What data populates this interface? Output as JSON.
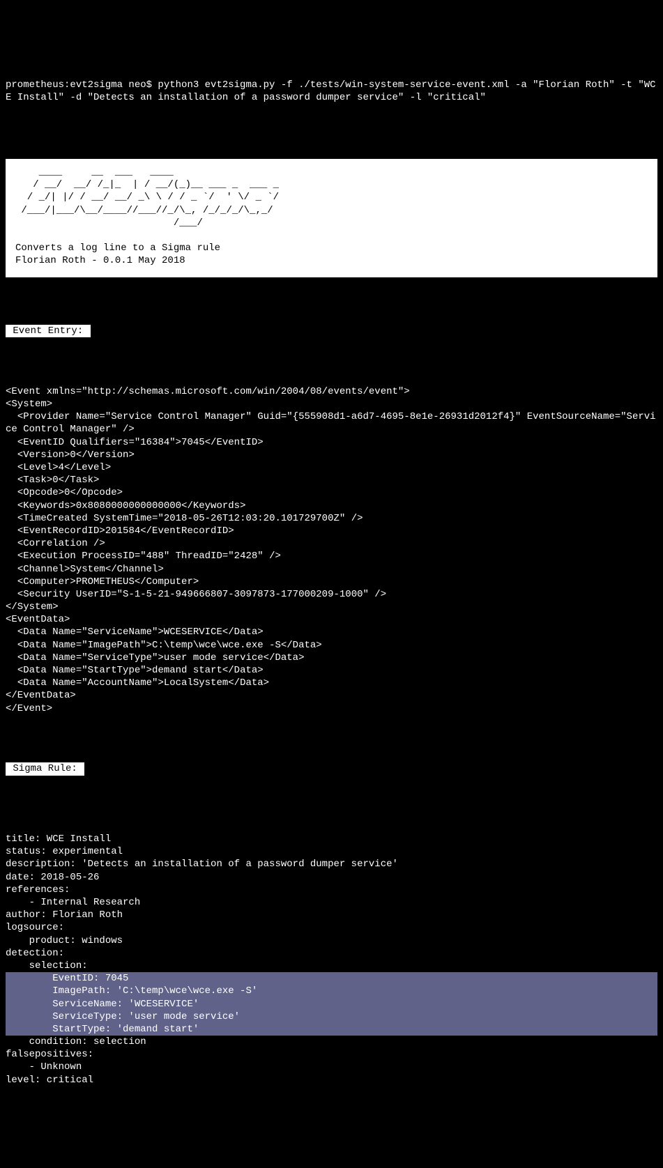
{
  "command": "prometheus:evt2sigma neo$ python3 evt2sigma.py -f ./tests/win-system-service-event.xml -a \"Florian Roth\" -t \"WCE Install\" -d \"Detects an installation of a password dumper service\" -l \"critical\"",
  "banner": {
    "ascii": "    ____     __  ___   ____                \n   / __/  __/ /_|_  | / __/(_)__ ___ _  ___ _\n  / _/| |/ / __/ __/ _\\ \\ / / _ `/  ' \\/ _ `/\n /___/|___/\\__/____//___//_/\\_, /_/_/_/\\_,_/ \n                           /___/             ",
    "tagline": "Converts a log line to a Sigma rule",
    "byline": "Florian Roth - 0.0.1 May 2018"
  },
  "labels": {
    "event_entry": " Event Entry: ",
    "sigma_rule": " Sigma Rule: "
  },
  "xml": "<Event xmlns=\"http://schemas.microsoft.com/win/2004/08/events/event\">\n<System>\n  <Provider Name=\"Service Control Manager\" Guid=\"{555908d1-a6d7-4695-8e1e-26931d2012f4}\" EventSourceName=\"Service Control Manager\" />\n  <EventID Qualifiers=\"16384\">7045</EventID>\n  <Version>0</Version>\n  <Level>4</Level>\n  <Task>0</Task>\n  <Opcode>0</Opcode>\n  <Keywords>0x8080000000000000</Keywords>\n  <TimeCreated SystemTime=\"2018-05-26T12:03:20.101729700Z\" />\n  <EventRecordID>201584</EventRecordID>\n  <Correlation />\n  <Execution ProcessID=\"488\" ThreadID=\"2428\" />\n  <Channel>System</Channel>\n  <Computer>PROMETHEUS</Computer>\n  <Security UserID=\"S-1-5-21-949666807-3097873-177000209-1000\" />\n</System>\n<EventData>\n  <Data Name=\"ServiceName\">WCESERVICE</Data>\n  <Data Name=\"ImagePath\">C:\\temp\\wce\\wce.exe -S</Data>\n  <Data Name=\"ServiceType\">user mode service</Data>\n  <Data Name=\"StartType\">demand start</Data>\n  <Data Name=\"AccountName\">LocalSystem</Data>\n</EventData>\n</Event>",
  "yaml_before": "title: WCE Install\nstatus: experimental\ndescription: 'Detects an installation of a password dumper service'\ndate: 2018-05-26\nreferences:\n    - Internal Research\nauthor: Florian Roth\nlogsource:\n    product: windows\ndetection:\n    selection:",
  "yaml_highlight": "        EventID: 7045\n        ImagePath: 'C:\\temp\\wce\\wce.exe -S'\n        ServiceName: 'WCESERVICE'\n        ServiceType: 'user mode service'\n        StartType: 'demand start'",
  "yaml_after": "    condition: selection\nfalsepositives:\n    - Unknown\nlevel: critical"
}
